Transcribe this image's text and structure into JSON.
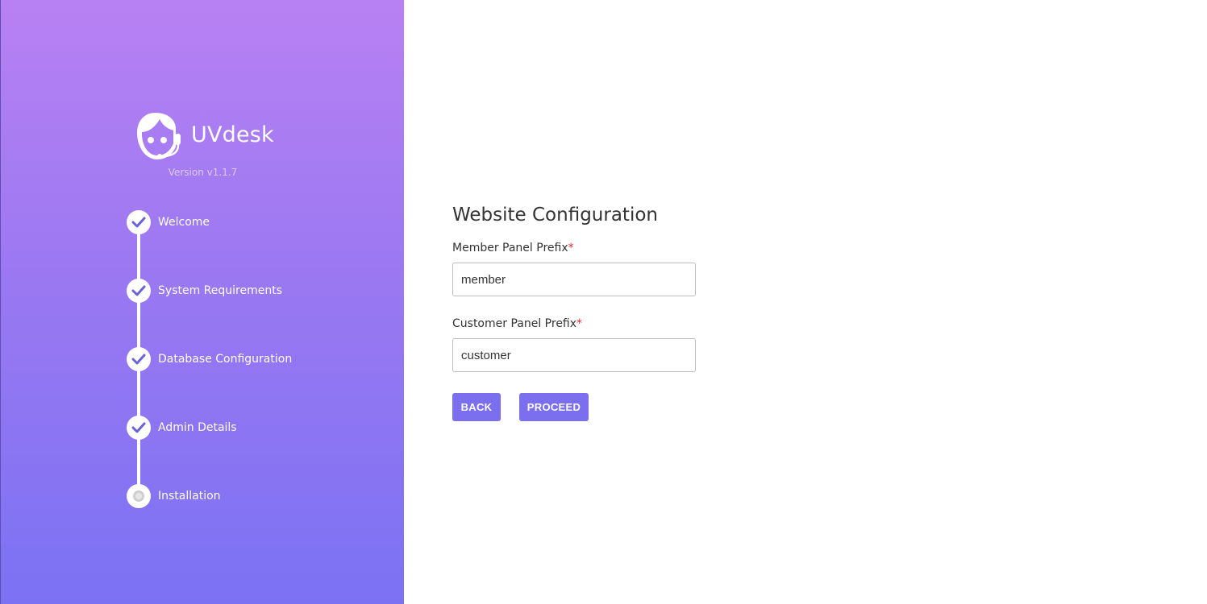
{
  "brand": {
    "name": "UVdesk",
    "version": "Version v1.1.7",
    "logo_icon": "uvdesk-support-agent-logo"
  },
  "steps": [
    {
      "label": "Welcome",
      "status": "done"
    },
    {
      "label": "System Requirements",
      "status": "done"
    },
    {
      "label": "Database Configuration",
      "status": "done"
    },
    {
      "label": "Admin Details",
      "status": "done"
    },
    {
      "label": "Installation",
      "status": "pending"
    }
  ],
  "form": {
    "title": "Website Configuration",
    "member_prefix": {
      "label": "Member Panel Prefix",
      "required_mark": "*",
      "value": "member"
    },
    "customer_prefix": {
      "label": "Customer Panel Prefix",
      "required_mark": "*",
      "value": "customer"
    }
  },
  "buttons": {
    "back": "BACK",
    "proceed": "PROCEED"
  },
  "colors": {
    "accent": "#7b6ff0",
    "gradient_top": "#b881f3",
    "gradient_bottom": "#7b72f3",
    "required": "#e02b2b"
  }
}
